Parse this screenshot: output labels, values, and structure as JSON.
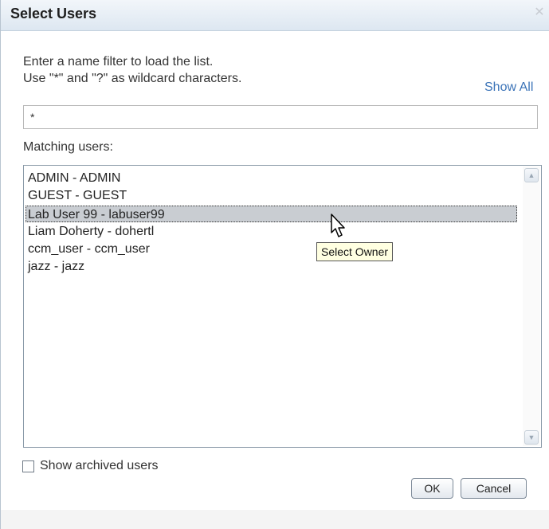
{
  "dialog": {
    "title": "Select Users",
    "close_icon": "close-icon"
  },
  "instructions": {
    "line1": "Enter a name filter to load the list.",
    "line2": "Use \"*\" and \"?\" as wildcard characters."
  },
  "show_all_label": "Show All",
  "filter": {
    "value": "*"
  },
  "matching_label": "Matching users:",
  "users": [
    "ADMIN - ADMIN",
    "GUEST - GUEST",
    "Lab User 99 - labuser99",
    "Liam Doherty - dohertl",
    "ccm_user - ccm_user",
    "jazz - jazz"
  ],
  "selected_user": "Lab User 99 - labuser99",
  "tooltip": "Select Owner",
  "show_archived": {
    "label": "Show archived users",
    "checked": false
  },
  "buttons": {
    "ok": "OK",
    "cancel": "Cancel"
  }
}
